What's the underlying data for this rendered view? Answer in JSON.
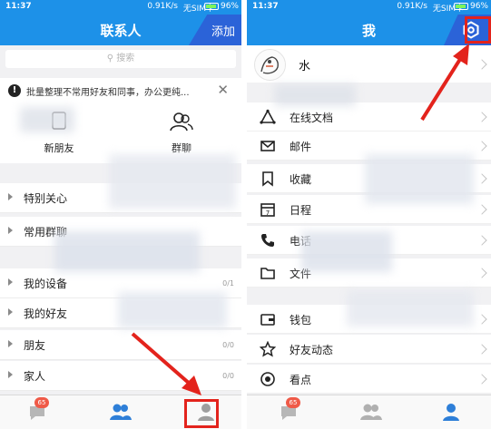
{
  "left": {
    "status": {
      "time": "11:37",
      "net": "0.91K/s",
      "sim": "无SIM卡",
      "battery": "96%"
    },
    "title": "联系人",
    "add_label": "添加",
    "search_placeholder": "搜索",
    "notice_text": "批量整理不常用好友和同事，办公更纯...",
    "notice_icon": "!",
    "quick": [
      {
        "label": "新朋友",
        "icon": "new-friend-icon"
      },
      {
        "label": "群聊",
        "icon": "group-chat-icon"
      }
    ],
    "groups": [
      {
        "name": "特别关心",
        "count": ""
      },
      {
        "name": "常用群聊",
        "count": ""
      },
      {
        "name": "我的设备",
        "count": "0/1"
      },
      {
        "name": "我的好友",
        "count": ""
      },
      {
        "name": "朋友",
        "count": "0/0"
      },
      {
        "name": "家人",
        "count": "0/0"
      }
    ],
    "tabs": {
      "messages_badge": "65"
    }
  },
  "right": {
    "status": {
      "time": "11:37",
      "net": "0.91K/s",
      "sim": "无SIM卡",
      "battery": "96%"
    },
    "title": "我",
    "profile_name": "水",
    "menu": [
      {
        "label": "在线文档",
        "icon": "online-doc-icon"
      },
      {
        "label": "邮件",
        "icon": "mail-icon"
      },
      {
        "label": "收藏",
        "icon": "favorite-icon"
      },
      {
        "label": "日程",
        "icon": "calendar-icon"
      },
      {
        "label": "电话",
        "icon": "phone-icon"
      },
      {
        "label": "文件",
        "icon": "folder-icon"
      },
      {
        "label": "钱包",
        "icon": "wallet-icon"
      },
      {
        "label": "好友动态",
        "icon": "star-icon"
      },
      {
        "label": "看点",
        "icon": "watch-icon"
      }
    ],
    "tabs": {
      "messages_badge": "65"
    }
  },
  "colors": {
    "accent": "#1d91e8",
    "accent_dark": "#2b63d8",
    "annotation": "#e3231c",
    "badge": "#ef5a48"
  }
}
